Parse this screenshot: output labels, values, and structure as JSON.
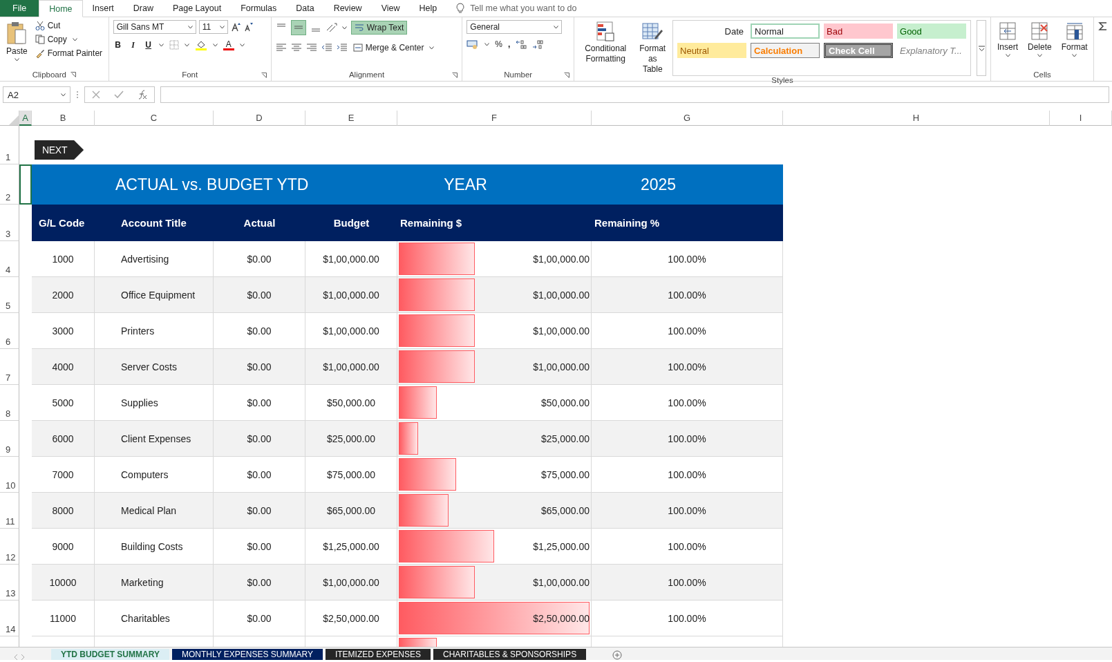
{
  "menu_tabs": [
    {
      "label": "File",
      "kind": "file",
      "selected": false
    },
    {
      "label": "Home",
      "kind": "tab",
      "selected": true
    },
    {
      "label": "Insert",
      "kind": "tab",
      "selected": false
    },
    {
      "label": "Draw",
      "kind": "tab",
      "selected": false
    },
    {
      "label": "Page Layout",
      "kind": "tab",
      "selected": false
    },
    {
      "label": "Formulas",
      "kind": "tab",
      "selected": false
    },
    {
      "label": "Data",
      "kind": "tab",
      "selected": false
    },
    {
      "label": "Review",
      "kind": "tab",
      "selected": false
    },
    {
      "label": "View",
      "kind": "tab",
      "selected": false
    },
    {
      "label": "Help",
      "kind": "tab",
      "selected": false
    }
  ],
  "tell_me": "Tell me what you want to do",
  "clipboard": {
    "paste": "Paste",
    "cut": "Cut",
    "copy": "Copy",
    "format_painter": "Format Painter",
    "label": "Clipboard"
  },
  "font": {
    "family": "Gill Sans MT",
    "size": "11",
    "bold": "B",
    "italic": "I",
    "underline": "U",
    "font_color": "A",
    "label": "Font"
  },
  "alignment": {
    "middle_align_selected": true,
    "wrap_text": "Wrap Text",
    "wrap_text_on": true,
    "merge": "Merge & Center",
    "label": "Alignment"
  },
  "number": {
    "format": "General",
    "percent": "%",
    "comma": ",",
    "label": "Number"
  },
  "styles": {
    "conditional": "Conditional Formatting",
    "format_as_table": "Format as Table",
    "label": "Styles",
    "cells": [
      {
        "label": "Date",
        "kind": "date"
      },
      {
        "label": "Normal",
        "kind": "normal"
      },
      {
        "label": "Bad",
        "kind": "bad"
      },
      {
        "label": "Good",
        "kind": "good"
      },
      {
        "label": "Neutral",
        "kind": "neutral"
      },
      {
        "label": "Calculation",
        "kind": "calculation"
      },
      {
        "label": "Check Cell",
        "kind": "check"
      },
      {
        "label": "Explanatory T...",
        "kind": "explanatory"
      }
    ]
  },
  "cells_group": {
    "insert": "Insert",
    "delete": "Delete",
    "format": "Format",
    "label": "Cells"
  },
  "formula_bar": {
    "name_box": "A2"
  },
  "columns": [
    {
      "label": "A",
      "selected": true
    },
    {
      "label": "B",
      "selected": false
    },
    {
      "label": "C",
      "selected": false
    },
    {
      "label": "D",
      "selected": false
    },
    {
      "label": "E",
      "selected": false
    },
    {
      "label": "F",
      "selected": false
    },
    {
      "label": "G",
      "selected": false
    },
    {
      "label": "H",
      "selected": false
    },
    {
      "label": "I",
      "selected": false
    }
  ],
  "next_button": "NEXT",
  "banner": {
    "title": "ACTUAL vs. BUDGET YTD",
    "year_label": "YEAR",
    "year": "2025"
  },
  "table": {
    "columns": [
      "G/L Code",
      "Account Title",
      "Actual",
      "Budget",
      "Remaining $",
      "Remaining %"
    ],
    "rows": [
      {
        "code": "1000",
        "title": "Advertising",
        "actual": "$0.00",
        "budget": "$1,00,000.00",
        "level": 0.4,
        "remaining": "$1,00,000.00",
        "pct": "100.00%"
      },
      {
        "code": "2000",
        "title": "Office Equipment",
        "actual": "$0.00",
        "budget": "$1,00,000.00",
        "level": 0.4,
        "remaining": "$1,00,000.00",
        "pct": "100.00%"
      },
      {
        "code": "3000",
        "title": "Printers",
        "actual": "$0.00",
        "budget": "$1,00,000.00",
        "level": 0.4,
        "remaining": "$1,00,000.00",
        "pct": "100.00%"
      },
      {
        "code": "4000",
        "title": "Server Costs",
        "actual": "$0.00",
        "budget": "$1,00,000.00",
        "level": 0.4,
        "remaining": "$1,00,000.00",
        "pct": "100.00%"
      },
      {
        "code": "5000",
        "title": "Supplies",
        "actual": "$0.00",
        "budget": "$50,000.00",
        "level": 0.2,
        "remaining": "$50,000.00",
        "pct": "100.00%"
      },
      {
        "code": "6000",
        "title": "Client Expenses",
        "actual": "$0.00",
        "budget": "$25,000.00",
        "level": 0.1,
        "remaining": "$25,000.00",
        "pct": "100.00%"
      },
      {
        "code": "7000",
        "title": "Computers",
        "actual": "$0.00",
        "budget": "$75,000.00",
        "level": 0.3,
        "remaining": "$75,000.00",
        "pct": "100.00%"
      },
      {
        "code": "8000",
        "title": "Medical Plan",
        "actual": "$0.00",
        "budget": "$65,000.00",
        "level": 0.26,
        "remaining": "$65,000.00",
        "pct": "100.00%"
      },
      {
        "code": "9000",
        "title": "Building Costs",
        "actual": "$0.00",
        "budget": "$1,25,000.00",
        "level": 0.5,
        "remaining": "$1,25,000.00",
        "pct": "100.00%"
      },
      {
        "code": "10000",
        "title": "Marketing",
        "actual": "$0.00",
        "budget": "$1,00,000.00",
        "level": 0.4,
        "remaining": "$1,00,000.00",
        "pct": "100.00%"
      },
      {
        "code": "11000",
        "title": "Charitables",
        "actual": "$0.00",
        "budget": "$2,50,000.00",
        "level": 1,
        "remaining": "$2,50,000.00",
        "pct": "100.00%"
      }
    ],
    "partial_row": {
      "level": 0.2
    }
  },
  "row_numbers": [
    "1",
    "2",
    "3",
    "4",
    "5",
    "6",
    "7",
    "8",
    "9",
    "10",
    "11",
    "12",
    "13",
    "14"
  ],
  "sheet_tabs": [
    {
      "label": "YTD BUDGET SUMMARY",
      "selected": true
    },
    {
      "label": "MONTHLY EXPENSES SUMMARY",
      "selected": false
    },
    {
      "label": "ITEMIZED EXPENSES",
      "selected": false
    },
    {
      "label": "CHARITABLES & SPONSORSHIPS",
      "selected": false
    }
  ]
}
